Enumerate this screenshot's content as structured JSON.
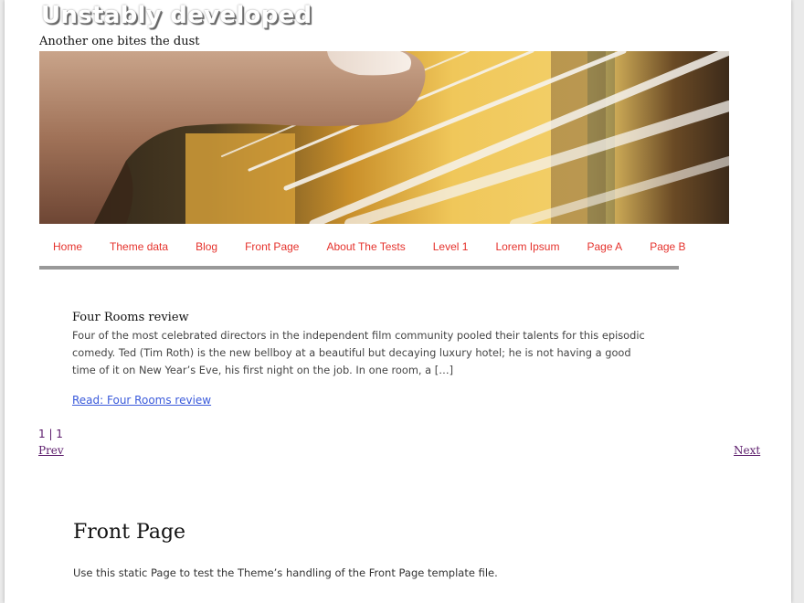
{
  "site": {
    "title": "Unstably developed",
    "description": "Another one bites the dust"
  },
  "nav": {
    "items": [
      {
        "label": "Home"
      },
      {
        "label": "Theme data"
      },
      {
        "label": "Blog"
      },
      {
        "label": "Front Page"
      },
      {
        "label": "About The Tests"
      },
      {
        "label": "Level 1"
      },
      {
        "label": "Lorem Ipsum"
      },
      {
        "label": "Page A"
      },
      {
        "label": "Page B"
      }
    ]
  },
  "post": {
    "title": "Four Rooms review",
    "excerpt": "Four of the most celebrated directors in the independent film community pooled their talents for this episodic comedy. Ted (Tim Roth) is the new bellboy at a beautiful but decaying luxury hotel; he is not having a good time of it on New Year’s Eve, his first night on the job. In one room, a […]",
    "read_more": "Read: Four Rooms review"
  },
  "pagination": {
    "count": "1 | 1",
    "prev": "Prev",
    "next": "Next"
  },
  "front_page": {
    "title": "Front Page",
    "text": "Use this static Page to test the Theme’s handling of the Front Page template file."
  },
  "colors": {
    "nav_link": "#e5322c",
    "read_more_link": "#3b5bdb",
    "pager_link": "#5b1b6b",
    "nav_border": "#999999"
  },
  "header_image": {
    "icon": "guitar-strings-photo"
  }
}
